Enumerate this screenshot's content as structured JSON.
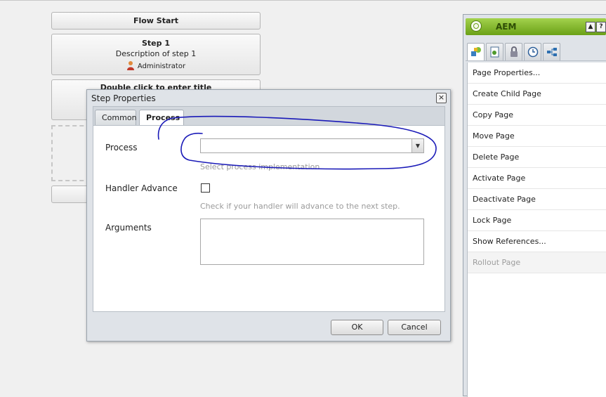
{
  "workflow": {
    "flow_start": "Flow Start",
    "step1": {
      "title": "Step 1",
      "description": "Description of step 1",
      "assignee": "Administrator"
    },
    "step2": {
      "title": "Double click to enter title"
    }
  },
  "dialog": {
    "title": "Step Properties",
    "tabs": [
      {
        "label": "Common"
      },
      {
        "label": "Process"
      }
    ],
    "active_tab": "Process",
    "fields": {
      "process": {
        "label": "Process",
        "value": "",
        "hint": "Select process implementation."
      },
      "handler_advance": {
        "label": "Handler Advance",
        "checked": false,
        "hint": "Check if your handler will advance to the next step."
      },
      "arguments": {
        "label": "Arguments",
        "value": ""
      }
    },
    "ok_label": "OK",
    "cancel_label": "Cancel"
  },
  "sidekick": {
    "title": "AEM",
    "tab_icons": [
      "components-icon",
      "page-icon",
      "lock-icon",
      "clock-icon",
      "workflow-icon"
    ],
    "items": [
      {
        "label": "Page Properties...",
        "enabled": true
      },
      {
        "label": "Create Child Page",
        "enabled": true
      },
      {
        "label": "Copy Page",
        "enabled": true
      },
      {
        "label": "Move Page",
        "enabled": true
      },
      {
        "label": "Delete Page",
        "enabled": true
      },
      {
        "label": "Activate Page",
        "enabled": true
      },
      {
        "label": "Deactivate Page",
        "enabled": true
      },
      {
        "label": "Lock Page",
        "enabled": true
      },
      {
        "label": "Show References...",
        "enabled": true
      },
      {
        "label": "Rollout Page",
        "enabled": false
      }
    ]
  },
  "colors": {
    "annotation": "#1a1ab8",
    "header_green": "#6aa016"
  }
}
